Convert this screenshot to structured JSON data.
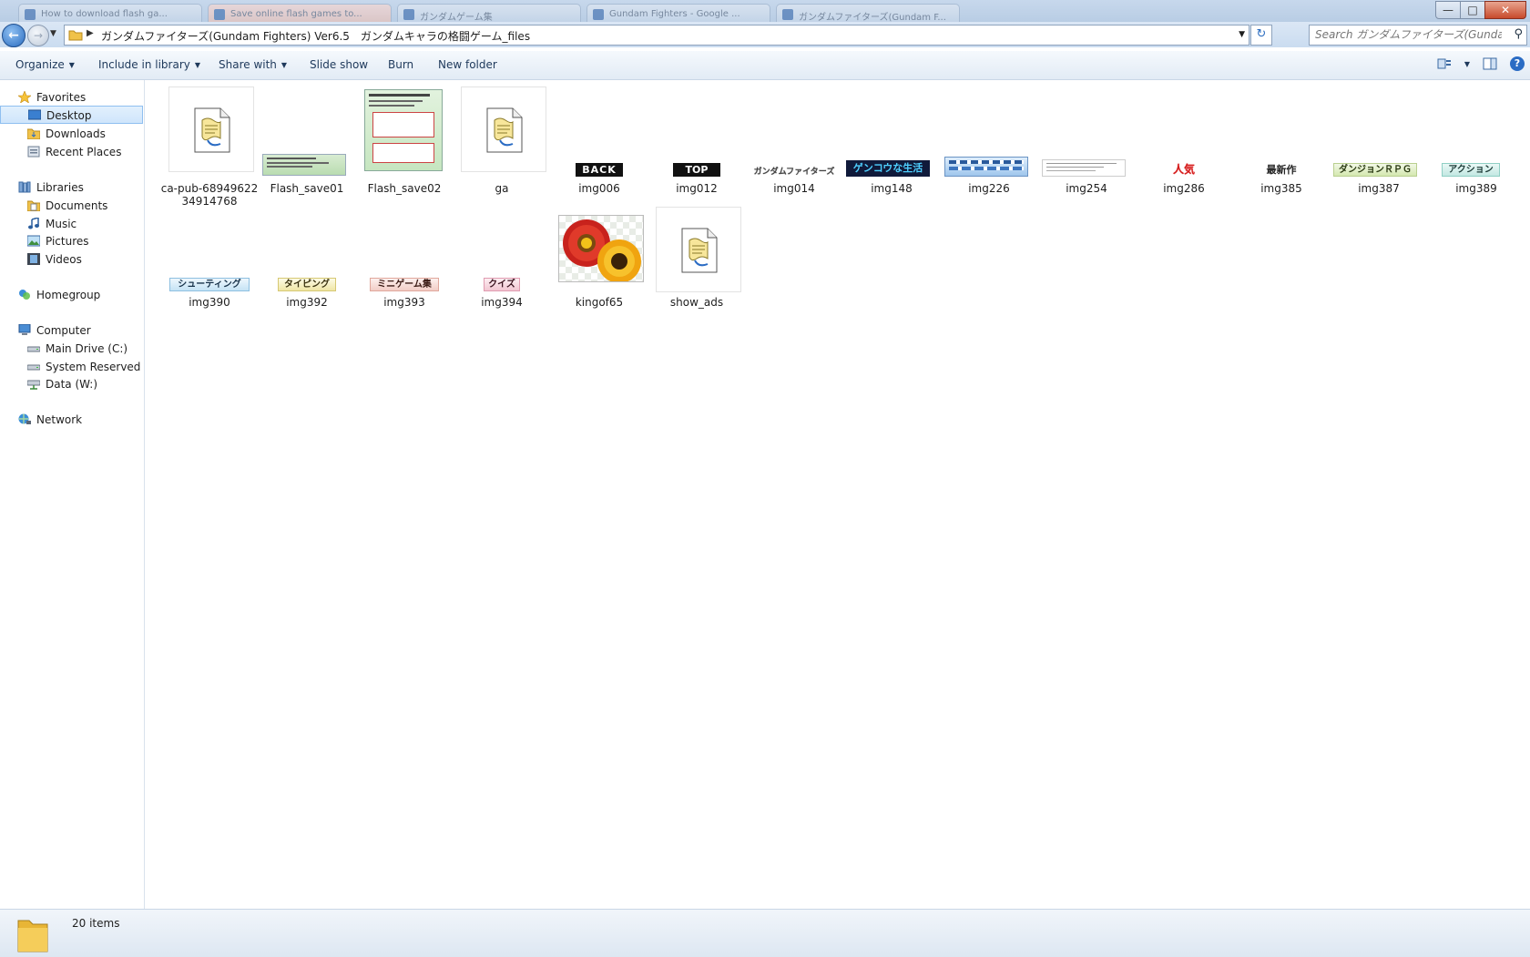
{
  "window": {
    "background_tabs": [
      "How to download flash ga...",
      "Save online flash games to...",
      "ガンダムゲーム集",
      "Gundam Fighters - Google ...",
      "ガンダムファイターズ(Gundam F..."
    ],
    "controls": {
      "minimize": "—",
      "maximize": "□",
      "close": "✕"
    }
  },
  "address": {
    "path": "ガンダムファイターズ(Gundam Fighters) Ver6.5　ガンダムキャラの格闘ゲーム_files"
  },
  "search": {
    "placeholder": "Search ガンダムファイターズ(Gunda..."
  },
  "toolbar": {
    "organize": "Organize",
    "include_in_library": "Include in library",
    "share_with": "Share with",
    "slide_show": "Slide show",
    "burn": "Burn",
    "new_folder": "New folder"
  },
  "nav": {
    "favorites": "Favorites",
    "desktop": "Desktop",
    "downloads": "Downloads",
    "recent_places": "Recent Places",
    "libraries": "Libraries",
    "documents": "Documents",
    "music": "Music",
    "pictures": "Pictures",
    "videos": "Videos",
    "homegroup": "Homegroup",
    "computer": "Computer",
    "main_drive": "Main Drive (C:)",
    "system_reserved": "System Reserved (E:)",
    "data_drive": "Data (W:)",
    "network": "Network"
  },
  "files": [
    {
      "name": "ca-pub-6894962234914768",
      "label_l1": "ca-pub-68949622",
      "label_l2": "34914768",
      "icon": "script-file-icon"
    },
    {
      "name": "Flash_save01",
      "icon": "screenshot-thumbnail"
    },
    {
      "name": "Flash_save02",
      "icon": "screenshot-thumbnail"
    },
    {
      "name": "ga",
      "icon": "script-file-icon"
    },
    {
      "name": "img006",
      "icon": "banner-thumbnail",
      "thumb_text": "BACK"
    },
    {
      "name": "img012",
      "icon": "banner-thumbnail",
      "thumb_text": "TOP"
    },
    {
      "name": "img014",
      "icon": "banner-thumbnail",
      "thumb_text": "ガンダムファイターズ"
    },
    {
      "name": "img148",
      "icon": "banner-thumbnail",
      "thumb_text": "ゲンコウな生活"
    },
    {
      "name": "img226",
      "icon": "banner-thumbnail"
    },
    {
      "name": "img254",
      "icon": "banner-thumbnail"
    },
    {
      "name": "img286",
      "icon": "banner-thumbnail",
      "thumb_text": "人気"
    },
    {
      "name": "img385",
      "icon": "banner-thumbnail",
      "thumb_text": "最新作"
    },
    {
      "name": "img387",
      "icon": "banner-thumbnail",
      "thumb_text": "ダンジョンＲＰＧ"
    },
    {
      "name": "img389",
      "icon": "banner-thumbnail",
      "thumb_text": "アクション"
    },
    {
      "name": "img390",
      "icon": "banner-thumbnail",
      "thumb_text": "シューティング"
    },
    {
      "name": "img392",
      "icon": "banner-thumbnail",
      "thumb_text": "タイピング"
    },
    {
      "name": "img393",
      "icon": "banner-thumbnail",
      "thumb_text": "ミニゲーム集"
    },
    {
      "name": "img394",
      "icon": "banner-thumbnail",
      "thumb_text": "クイズ"
    },
    {
      "name": "kingof65",
      "icon": "flower-photo-thumbnail"
    },
    {
      "name": "show_ads",
      "icon": "script-file-icon"
    }
  ],
  "status": {
    "count": "20 items"
  }
}
